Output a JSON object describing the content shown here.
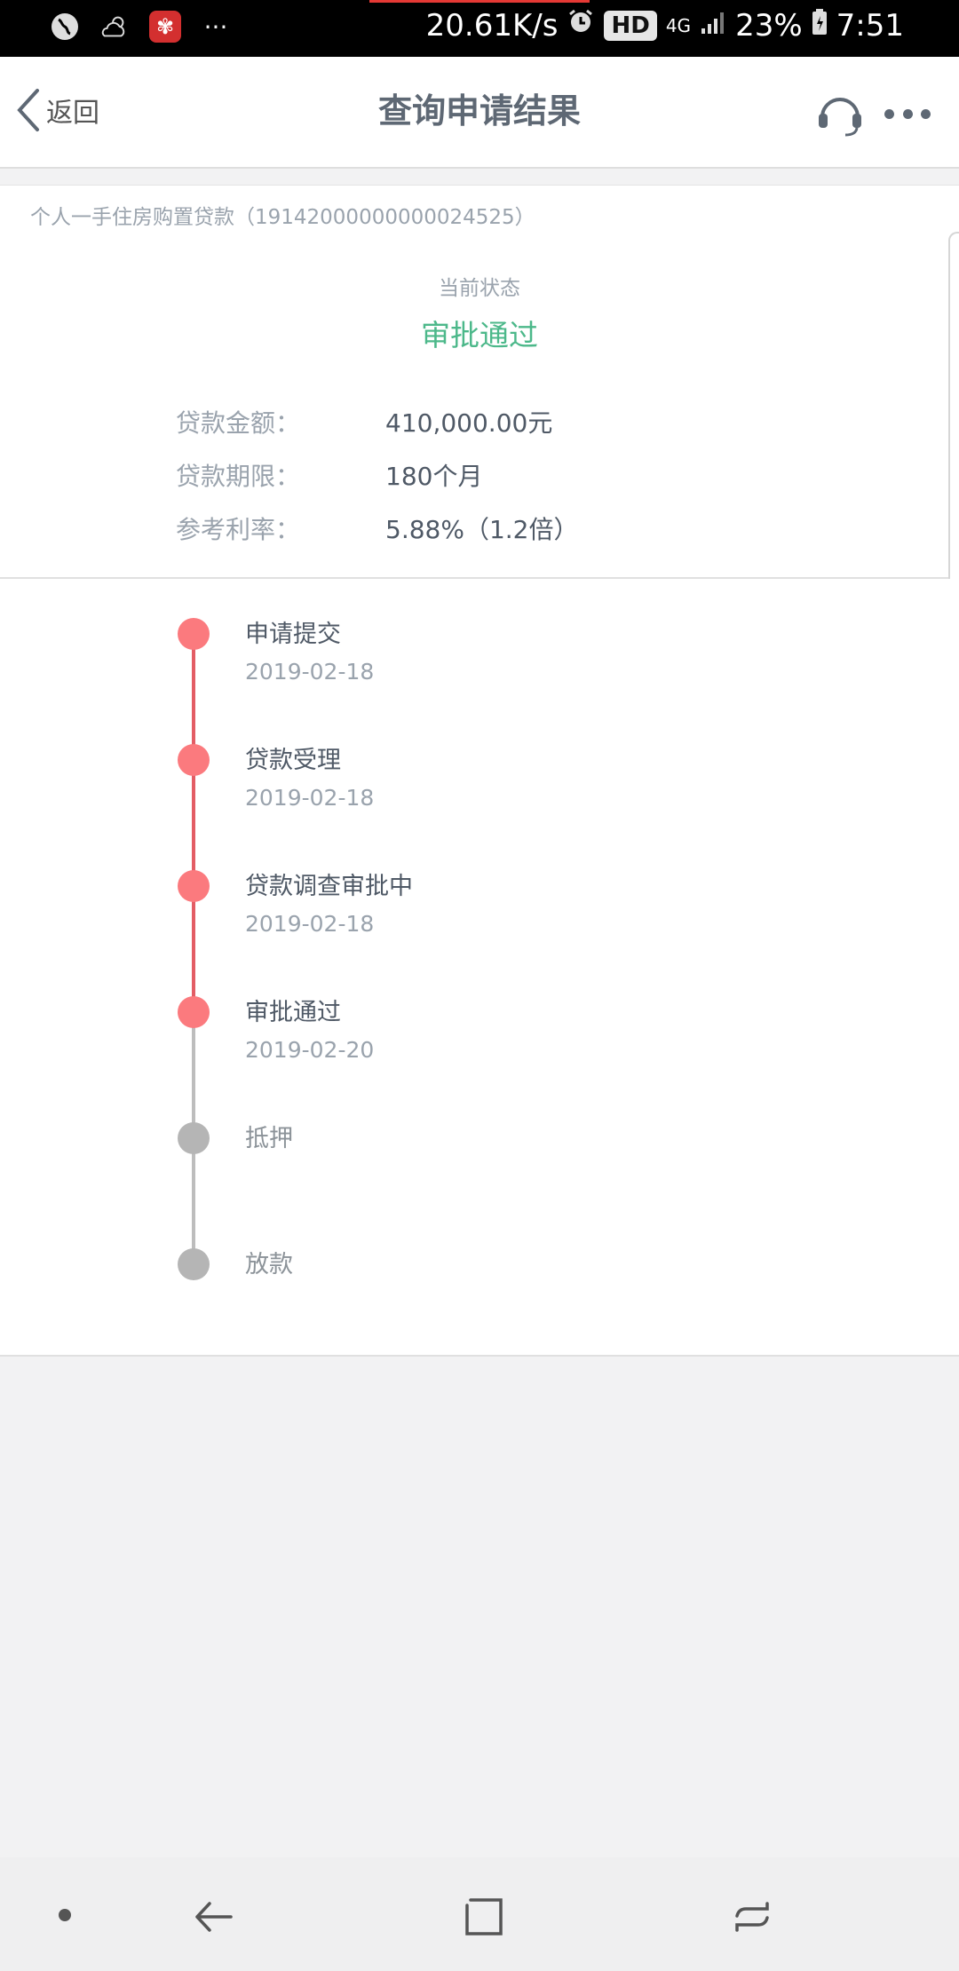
{
  "status_bar": {
    "net_speed": "20.61K/s",
    "hd": "HD",
    "network": "4G",
    "battery": "23%",
    "time": "7:51",
    "overflow": "···"
  },
  "nav": {
    "back_label": "返回",
    "title": "查询申请结果"
  },
  "loan": {
    "product": "个人一手住房购置贷款（19142000000000024525）",
    "status_caption": "当前状态",
    "status_value": "审批通过",
    "status_color": "#4cb88a",
    "details": [
      {
        "key": "贷款金额：",
        "value": "410,000.00元"
      },
      {
        "key": "贷款期限：",
        "value": "180个月"
      },
      {
        "key": "参考利率：",
        "value": "5.88%（1.2倍）"
      }
    ]
  },
  "timeline": {
    "done_color": "#fb7a7e",
    "pending_color": "#b5b5b5",
    "steps": [
      {
        "label": "申请提交",
        "date": "2019-02-18",
        "done": true
      },
      {
        "label": "贷款受理",
        "date": "2019-02-18",
        "done": true
      },
      {
        "label": "贷款调查审批中",
        "date": "2019-02-18",
        "done": true
      },
      {
        "label": "审批通过",
        "date": "2019-02-20",
        "done": true
      },
      {
        "label": "抵押",
        "date": "",
        "done": false
      },
      {
        "label": "放款",
        "date": "",
        "done": false
      }
    ]
  }
}
